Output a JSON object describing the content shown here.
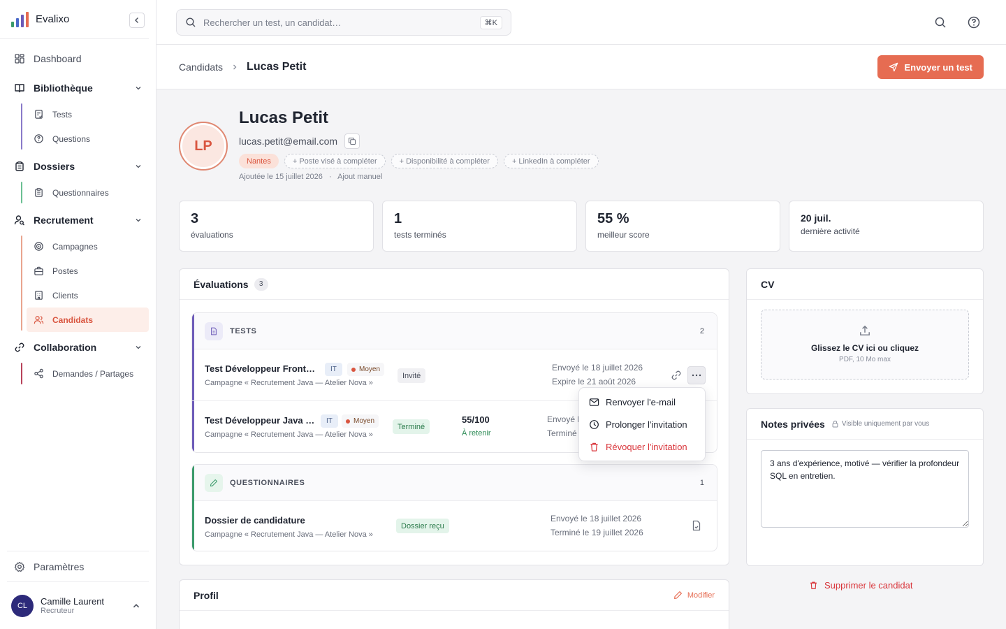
{
  "app": {
    "name": "Evalixo"
  },
  "sidebar": {
    "dashboard": "Dashboard",
    "sections": [
      {
        "label": "Bibliothèque",
        "items": [
          "Tests",
          "Questions"
        ]
      },
      {
        "label": "Dossiers",
        "items": [
          "Questionnaires"
        ]
      },
      {
        "label": "Recrutement",
        "items": [
          "Campagnes",
          "Postes",
          "Clients",
          "Candidats"
        ]
      },
      {
        "label": "Collaboration",
        "items": [
          "Demandes / Partages"
        ]
      }
    ],
    "active_item": "Candidats",
    "settings": "Paramètres",
    "user": {
      "initials": "CL",
      "name": "Camille Laurent",
      "role": "Recruteur"
    }
  },
  "search": {
    "placeholder": "Rechercher un test, un candidat…",
    "shortcut": "⌘K"
  },
  "breadcrumb": {
    "parent": "Candidats",
    "current": "Lucas Petit"
  },
  "actions": {
    "send_test": "Envoyer un test"
  },
  "candidate": {
    "initials": "LP",
    "name": "Lucas Petit",
    "email": "lucas.petit@email.com",
    "tags": {
      "city": "Nantes",
      "todo": [
        "+ Poste visé à compléter",
        "+ Disponibilité à compléter",
        "+ LinkedIn à compléter"
      ]
    },
    "added": "Ajoutée le 15 juillet 2026",
    "source": "Ajout manuel"
  },
  "stats": [
    {
      "value": "3",
      "label": "évaluations"
    },
    {
      "value": "1",
      "label": "tests terminés"
    },
    {
      "value": "55 %",
      "label": "meilleur score"
    },
    {
      "value": "20 juil.",
      "label": "dernière activité"
    }
  ],
  "evaluations": {
    "title": "Évaluations",
    "count": "3",
    "tests": {
      "label": "TESTS",
      "count": "2",
      "rows": [
        {
          "title": "Test Développeur Front…",
          "category": "IT",
          "level": "Moyen",
          "campaign": "Campagne « Recrutement Java — Atelier Nova »",
          "status": "Invité",
          "sent": "Envoyé le 18 juillet 2026",
          "second": "Expire le 21 août 2026"
        },
        {
          "title": "Test Développeur Java …",
          "category": "IT",
          "level": "Moyen",
          "campaign": "Campagne « Recrutement Java — Atelier Nova »",
          "status": "Terminé",
          "score": "55/100",
          "verdict": "À retenir",
          "sent": "Envoyé l",
          "second": "Terminé"
        }
      ]
    },
    "questionnaires": {
      "label": "QUESTIONNAIRES",
      "count": "1",
      "rows": [
        {
          "title": "Dossier de candidature",
          "campaign": "Campagne « Recrutement Java — Atelier Nova »",
          "status": "Dossier reçu",
          "sent": "Envoyé le 18 juillet 2026",
          "second": "Terminé le 19 juillet 2026"
        }
      ]
    }
  },
  "row_menu": {
    "items": [
      "Renvoyer l'e-mail",
      "Prolonger l'invitation",
      "Révoquer l'invitation"
    ]
  },
  "cv": {
    "title": "CV",
    "drop_label": "Glissez le CV ici ou cliquez",
    "hint": "PDF, 10 Mo max"
  },
  "notes": {
    "title": "Notes privées",
    "visibility": "Visible uniquement par vous",
    "value": "3 ans d'expérience, motivé — vérifier la profondeur SQL en entretien."
  },
  "profile": {
    "title": "Profil",
    "edit": "Modifier"
  },
  "delete_candidate": "Supprimer le candidat",
  "colors": {
    "accent": "#e66c52",
    "danger": "#d9343a",
    "success": "#2a7a4a",
    "tests_bar": "#6d5bb8",
    "questionnaires_bar": "#3a9a6a"
  }
}
